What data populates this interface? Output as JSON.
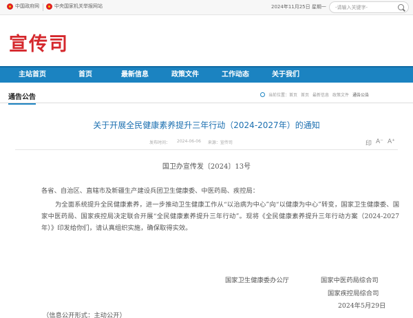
{
  "topbar": {
    "gov_link": "中国政府网",
    "org_link": "中央国家机关举报网站",
    "date": "2024年11月25日 星期一",
    "search_placeholder": "-请输入关键字-"
  },
  "header": {
    "site_title": "宣传司"
  },
  "nav": {
    "items": [
      {
        "label": "主站首页"
      },
      {
        "label": "首页"
      },
      {
        "label": "最新信息"
      },
      {
        "label": "政策文件"
      },
      {
        "label": "工作动态"
      },
      {
        "label": "关于我们"
      }
    ]
  },
  "section": {
    "title": "通告公告",
    "breadcrumb": [
      "当前位置：首页",
      "首页",
      "最新信息",
      "政策文件",
      "通告公告"
    ]
  },
  "article": {
    "title": "关于开展全民健康素养提升三年行动（2024-2027年）的通知",
    "meta": [
      "发布时间：",
      "2024-06-06",
      "来源：宣传司"
    ],
    "tools": {
      "print": "印",
      "zoom_out": "A⁻",
      "zoom_in": "A⁺"
    },
    "doc_number": "国卫办宣传发〔2024〕13号",
    "addressee": "各省、自治区、直辖市及新疆生产建设兵团卫生健康委、中医药局、疾控局：",
    "paragraph": "为全面系统提升全民健康素养，进一步推动卫生健康工作从“以治病为中心”向“以健康为中心”转变，国家卫生健康委、国家中医药局、国家疾控局决定联合开展“全民健康素养提升三年行动”。现将《全民健康素养提升三年行动方案（2024-2027年）》印发给你们，请认真组织实施，确保取得实效。",
    "signers": {
      "nhc": "国家卫生健康委办公厅",
      "tcm": "国家中医药局综合司",
      "cdc": "国家疾控局综合司",
      "date": "2024年5月29日"
    },
    "disclosure": "（信息公开形式：主动公开）"
  }
}
